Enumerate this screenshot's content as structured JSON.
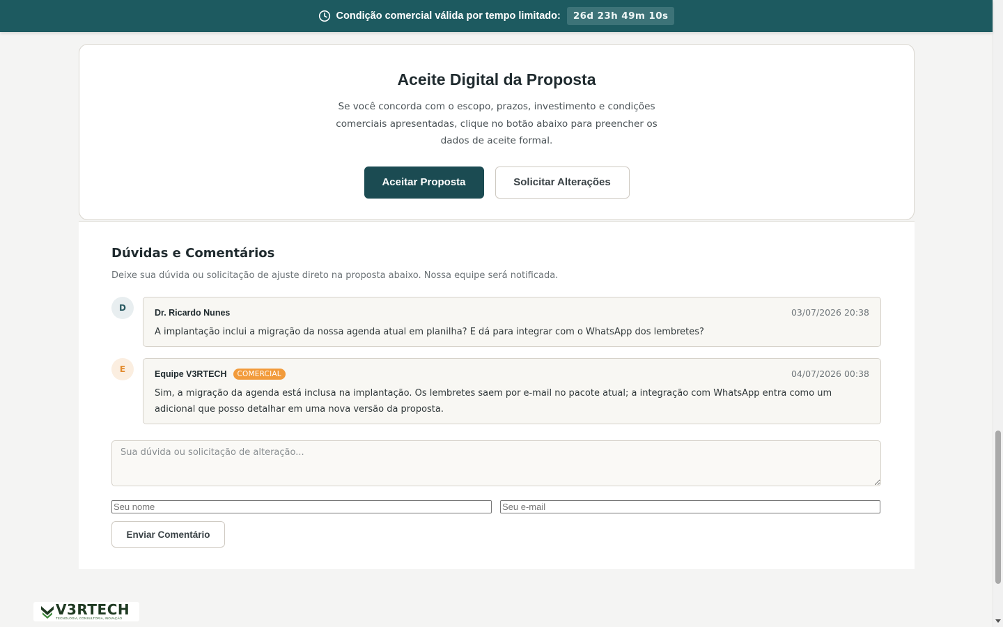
{
  "banner": {
    "text": "Condição comercial válida por tempo limitado:",
    "countdown": "26d 23h 49m 10s",
    "icon": "clock-icon"
  },
  "acceptance": {
    "title": "Aceite Digital da Proposta",
    "description": "Se você concorda com o escopo, prazos, investimento e condições comerciais apresentadas, clique no botão abaixo para preencher os dados de aceite formal.",
    "accept_label": "Aceitar Proposta",
    "request_changes_label": "Solicitar Alterações"
  },
  "comments": {
    "title": "Dúvidas e Comentários",
    "subtitle": "Deixe sua dúvida ou solicitação de ajuste direto na proposta abaixo. Nossa equipe será notificada.",
    "items": [
      {
        "initial": "D",
        "author": "Dr. Ricardo Nunes",
        "badge": "",
        "date": "03/07/2026 20:38",
        "text": "A implantação inclui a migração da nossa agenda atual em planilha? E dá para integrar com o WhatsApp dos lembretes?"
      },
      {
        "initial": "E",
        "author": "Equipe V3RTECH",
        "badge": "COMERCIAL",
        "date": "04/07/2026 00:38",
        "text": "Sim, a migração da agenda está inclusa na implantação. Os lembretes saem por e-mail no pacote atual; a integração com WhatsApp entra como um adicional que posso detalhar em uma nova versão da proposta."
      }
    ],
    "textarea_placeholder": "Sua dúvida ou solicitação de alteração...",
    "name_placeholder": "Seu nome",
    "email_placeholder": "Seu e-mail",
    "send_label": "Enviar Comentário"
  },
  "footer": {
    "logo_name": "V3RTECH",
    "logo_tagline": "TECNOLOGIA, CONSULTORIA, INOVAÇÃO"
  },
  "colors": {
    "banner": "#1d5a60",
    "primary": "#1b4b52",
    "badge": "#f29b3b",
    "logo_green": "#1f3a22"
  }
}
